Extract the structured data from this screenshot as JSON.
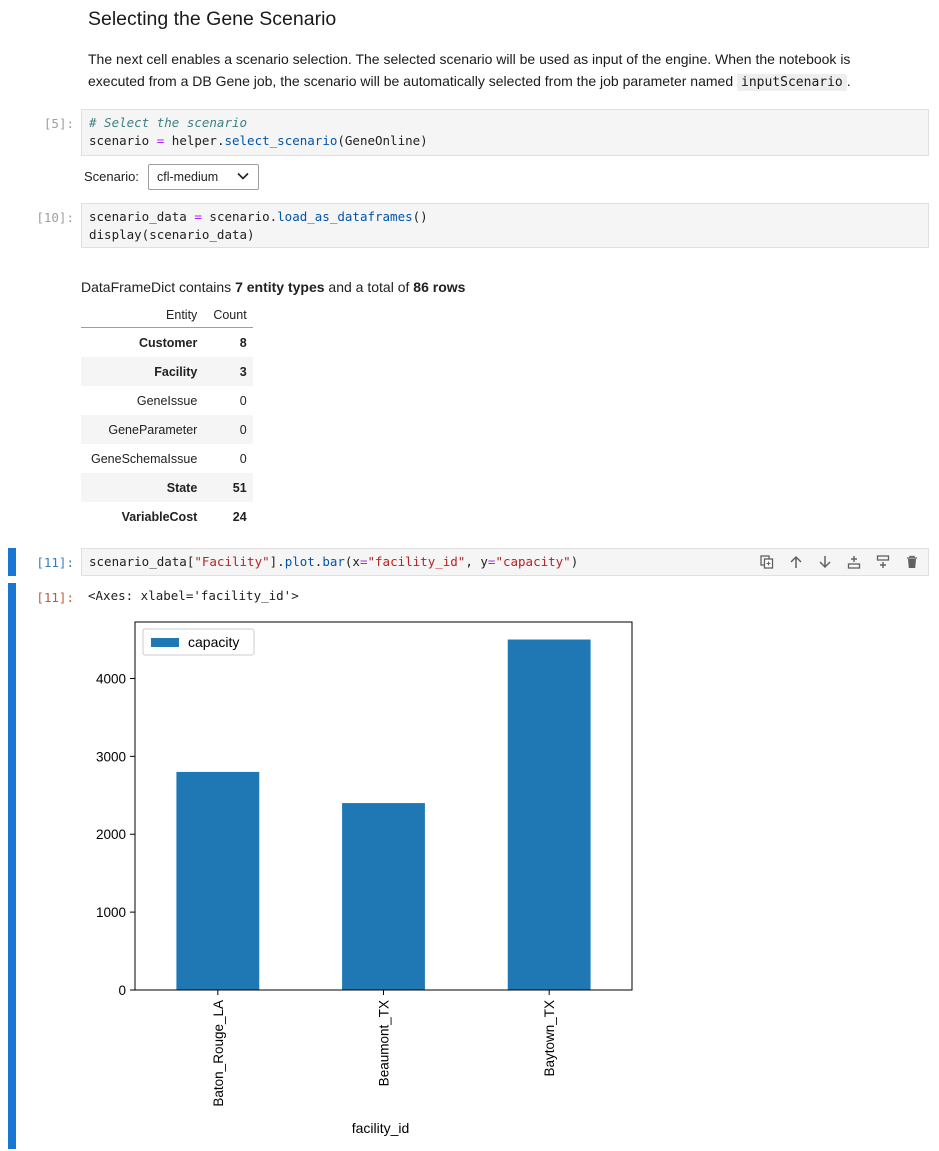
{
  "markdown": {
    "title": "Selecting the Gene Scenario",
    "para_before": "The next cell enables a scenario selection. The selected scenario will be used as input of the engine. When the notebook is executed from a DB Gene job, the scenario will be automatically selected from the job parameter named ",
    "code": "inputScenario",
    "para_after": "."
  },
  "cell5": {
    "prompt": "[5]:",
    "comment": "# Select the scenario",
    "line2_a": "scenario ",
    "line2_eq": "=",
    "line2_b": " helper.",
    "line2_fn": "select_scenario",
    "line2_c": "(GeneOnline)"
  },
  "widget": {
    "label": "Scenario:",
    "value": "cfl-medium"
  },
  "cell10": {
    "prompt": "[10]:",
    "l1_a": "scenario_data ",
    "l1_eq": "=",
    "l1_b": " scenario.",
    "l1_fn": "load_as_dataframes",
    "l1_c": "()",
    "l2": "display(scenario_data)"
  },
  "summary": {
    "pre": "DataFrameDict contains ",
    "entity_types": "7 entity types",
    "mid": " and a total of ",
    "rows": "86 rows"
  },
  "table": {
    "headers": [
      "Entity",
      "Count"
    ],
    "rows": [
      {
        "entity": "Customer",
        "count": "8"
      },
      {
        "entity": "Facility",
        "count": "3"
      },
      {
        "entity": "GeneIssue",
        "count": "0"
      },
      {
        "entity": "GeneParameter",
        "count": "0"
      },
      {
        "entity": "GeneSchemaIssue",
        "count": "0"
      },
      {
        "entity": "State",
        "count": "51"
      },
      {
        "entity": "VariableCost",
        "count": "24"
      }
    ]
  },
  "cell11": {
    "prompt": "[11]:",
    "a": "scenario_data[",
    "s1": "\"Facility\"",
    "b": "].",
    "p1": "plot",
    "c": ".",
    "p2": "bar",
    "d": "(x",
    "eq1": "=",
    "s2": "\"facility_id\"",
    "e": ", y",
    "eq2": "=",
    "s3": "\"capacity\"",
    "f": ")",
    "out_prompt": "[11]:",
    "out_text": "<Axes: xlabel='facility_id'>"
  },
  "toolbar_icons": [
    "duplicate-icon",
    "arrow-up-icon",
    "arrow-down-icon",
    "insert-above-icon",
    "insert-below-icon",
    "trash-icon"
  ],
  "chart_data": {
    "type": "bar",
    "categories": [
      "Baton_Rouge_LA",
      "Beaumont_TX",
      "Baytown_TX"
    ],
    "series": [
      {
        "name": "capacity",
        "values": [
          2800,
          2400,
          4500
        ],
        "color": "#1f77b4"
      }
    ],
    "xlabel": "facility_id",
    "ylabel": "",
    "ylim": [
      0,
      4725
    ],
    "yticks": [
      0,
      1000,
      2000,
      3000,
      4000
    ],
    "legend": "top-left",
    "grid": false
  }
}
